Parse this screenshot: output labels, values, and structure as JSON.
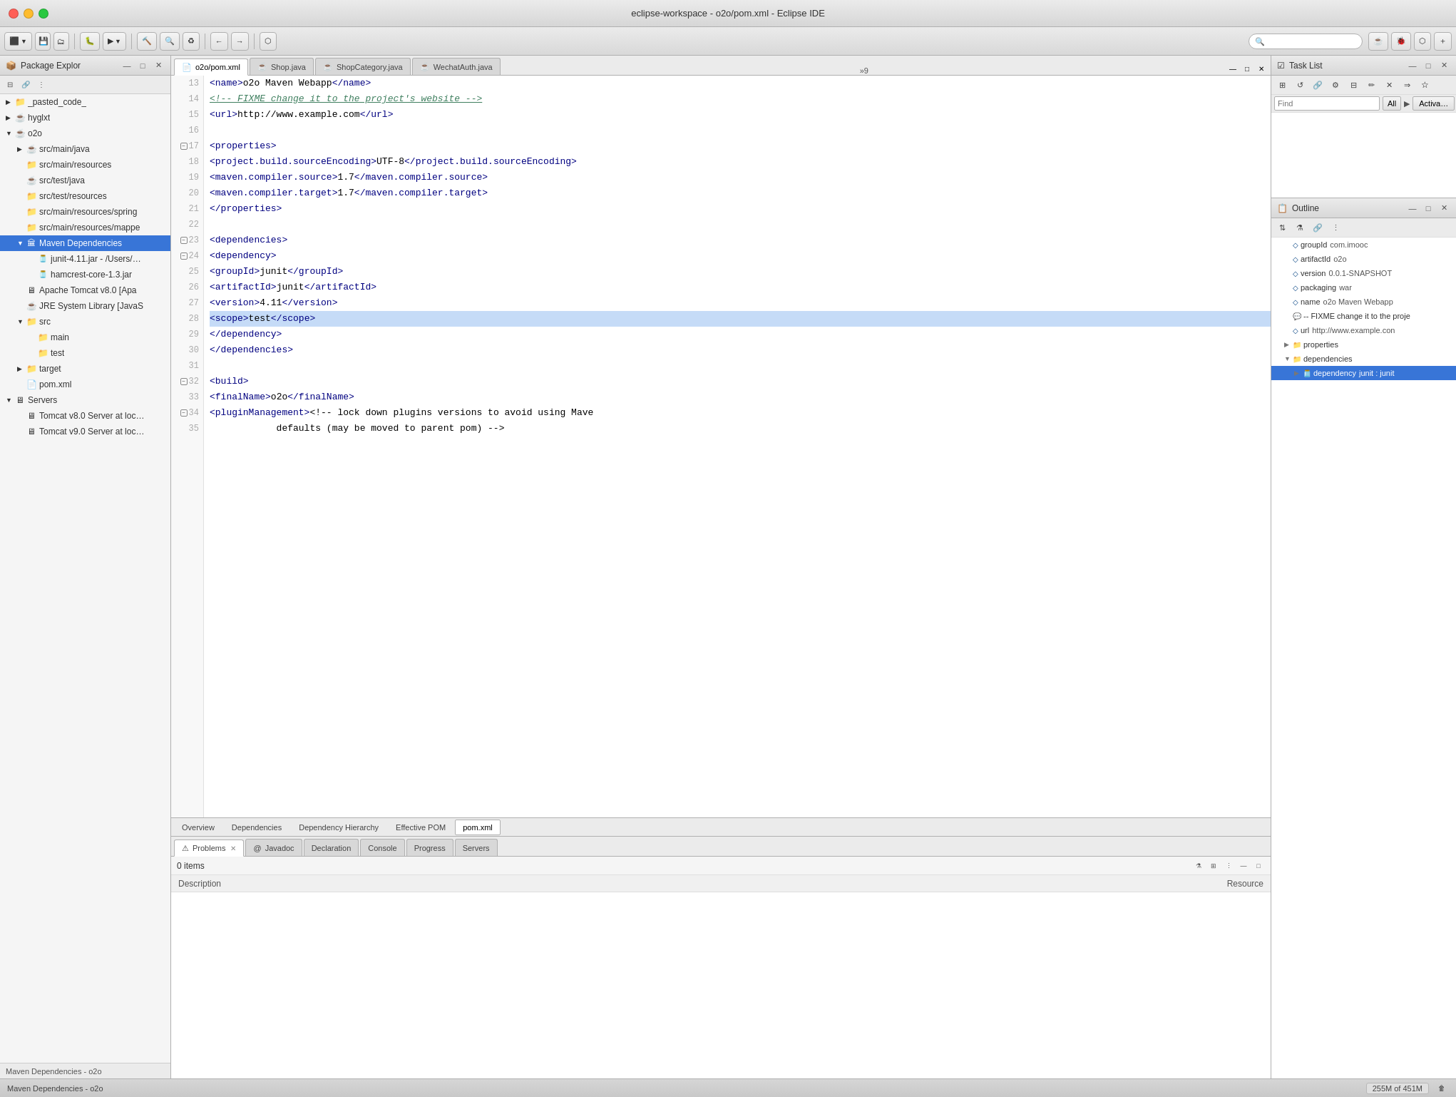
{
  "window": {
    "title": "eclipse-workspace - o2o/pom.xml - Eclipse IDE",
    "traffic_lights": [
      "close",
      "minimize",
      "maximize"
    ]
  },
  "titlebar": {
    "icon": "🔒",
    "title": "eclipse-workspace - o2o/pom.xml - Eclipse IDE"
  },
  "editor_tabs": [
    {
      "id": "pom-xml",
      "label": "o2o/pom.xml",
      "icon": "xml",
      "active": false,
      "closeable": true
    },
    {
      "id": "shop-java",
      "label": "Shop.java",
      "icon": "java",
      "active": false,
      "closeable": true
    },
    {
      "id": "shopcategory-java",
      "label": "ShopCategory.java",
      "icon": "java",
      "active": false,
      "closeable": true
    },
    {
      "id": "wechatauth-java",
      "label": "WechatAuth.java",
      "icon": "java",
      "active": false,
      "closeable": true
    }
  ],
  "editor_tab_overflow": "»9",
  "code_lines": [
    {
      "num": "13",
      "content": "    <name>o2o Maven Webapp</name>",
      "fold": false,
      "highlighted": false
    },
    {
      "num": "14",
      "content": "    <!-- FIXME change it to the project's website -->",
      "fold": false,
      "highlighted": false
    },
    {
      "num": "15",
      "content": "    <url>http://www.example.com</url>",
      "fold": false,
      "highlighted": false
    },
    {
      "num": "16",
      "content": "",
      "fold": false,
      "highlighted": false
    },
    {
      "num": "17",
      "content": "    <properties>",
      "fold": true,
      "highlighted": false
    },
    {
      "num": "18",
      "content": "        <project.build.sourceEncoding>UTF-8</project.build.sourceEncoding>",
      "fold": false,
      "highlighted": false
    },
    {
      "num": "19",
      "content": "        <maven.compiler.source>1.7</maven.compiler.source>",
      "fold": false,
      "highlighted": false
    },
    {
      "num": "20",
      "content": "        <maven.compiler.target>1.7</maven.compiler.target>",
      "fold": false,
      "highlighted": false
    },
    {
      "num": "21",
      "content": "    </properties>",
      "fold": false,
      "highlighted": false
    },
    {
      "num": "22",
      "content": "",
      "fold": false,
      "highlighted": false
    },
    {
      "num": "23",
      "content": "    <dependencies>",
      "fold": true,
      "highlighted": false
    },
    {
      "num": "24",
      "content": "        <dependency>",
      "fold": true,
      "highlighted": false
    },
    {
      "num": "25",
      "content": "            <groupId>junit</groupId>",
      "fold": false,
      "highlighted": false
    },
    {
      "num": "26",
      "content": "            <artifactId>junit</artifactId>",
      "fold": false,
      "highlighted": false
    },
    {
      "num": "27",
      "content": "            <version>4.11</version>",
      "fold": false,
      "highlighted": false
    },
    {
      "num": "28",
      "content": "            <scope>test</scope>",
      "fold": false,
      "highlighted": true
    },
    {
      "num": "29",
      "content": "        </dependency>",
      "fold": false,
      "highlighted": false
    },
    {
      "num": "30",
      "content": "    </dependencies>",
      "fold": false,
      "highlighted": false
    },
    {
      "num": "31",
      "content": "",
      "fold": false,
      "highlighted": false
    },
    {
      "num": "32",
      "content": "    <build>",
      "fold": true,
      "highlighted": false
    },
    {
      "num": "33",
      "content": "        <finalName>o2o</finalName>",
      "fold": false,
      "highlighted": false
    },
    {
      "num": "34",
      "content": "        <pluginManagement><!-- lock down plugins versions to avoid using Mave",
      "fold": true,
      "highlighted": false
    },
    {
      "num": "35",
      "content": "            defaults (may be moved to parent pom) -->",
      "fold": false,
      "highlighted": false
    }
  ],
  "bottom_editor_tabs": [
    {
      "label": "Overview"
    },
    {
      "label": "Dependencies"
    },
    {
      "label": "Dependency Hierarchy"
    },
    {
      "label": "Effective POM"
    },
    {
      "label": "pom.xml",
      "active": true
    }
  ],
  "package_explorer": {
    "title": "Package Explor",
    "items": [
      {
        "level": 0,
        "label": "_pasted_code_",
        "arrow": "▶",
        "icon": "📁",
        "type": "folder"
      },
      {
        "level": 0,
        "label": "hyglxt",
        "arrow": "▶",
        "icon": "☕",
        "type": "project"
      },
      {
        "level": 0,
        "label": "o2o",
        "arrow": "▼",
        "icon": "☕",
        "type": "project"
      },
      {
        "level": 1,
        "label": "src/main/java",
        "arrow": "▶",
        "icon": "📁",
        "type": "src"
      },
      {
        "level": 1,
        "label": "src/main/resources",
        "arrow": " ",
        "icon": "📁",
        "type": "res"
      },
      {
        "level": 1,
        "label": "src/test/java",
        "arrow": " ",
        "icon": "📁",
        "type": "src"
      },
      {
        "level": 1,
        "label": "src/test/resources",
        "arrow": " ",
        "icon": "📁",
        "type": "res"
      },
      {
        "level": 1,
        "label": "src/main/resources/spring",
        "arrow": " ",
        "icon": "📁",
        "type": "res"
      },
      {
        "level": 1,
        "label": "src/main/resources/mappe",
        "arrow": " ",
        "icon": "📁",
        "type": "res"
      },
      {
        "level": 1,
        "label": "Maven Dependencies",
        "arrow": "▼",
        "icon": "🏛",
        "type": "mvn",
        "selected": true
      },
      {
        "level": 2,
        "label": "junit-4.11.jar - /Users/…",
        "arrow": " ",
        "icon": "🫙",
        "type": "jar"
      },
      {
        "level": 2,
        "label": "hamcrest-core-1.3.jar",
        "arrow": " ",
        "icon": "🫙",
        "type": "jar"
      },
      {
        "level": 1,
        "label": "Apache Tomcat v8.0 [Apa",
        "arrow": " ",
        "icon": "🐱",
        "type": "server"
      },
      {
        "level": 1,
        "label": "JRE System Library [JavaS",
        "arrow": " ",
        "icon": "☕",
        "type": "jre"
      },
      {
        "level": 1,
        "label": "src",
        "arrow": "▼",
        "icon": "📁",
        "type": "folder"
      },
      {
        "level": 2,
        "label": "main",
        "arrow": " ",
        "icon": "📁",
        "type": "folder"
      },
      {
        "level": 2,
        "label": "test",
        "arrow": " ",
        "icon": "📁",
        "type": "folder"
      },
      {
        "level": 1,
        "label": "target",
        "arrow": "▶",
        "icon": "📁",
        "type": "folder"
      },
      {
        "level": 1,
        "label": "pom.xml",
        "arrow": " ",
        "icon": "📄",
        "type": "file"
      },
      {
        "level": 0,
        "label": "Servers",
        "arrow": "▼",
        "icon": "🖥",
        "type": "server-group"
      },
      {
        "level": 1,
        "label": "Tomcat v8.0 Server at loc…",
        "arrow": " ",
        "icon": "🖥",
        "type": "server-inst"
      },
      {
        "level": 1,
        "label": "Tomcat v9.0 Server at loc…",
        "arrow": " ",
        "icon": "🖥",
        "type": "server-inst"
      }
    ],
    "footer": "Maven Dependencies - o2o"
  },
  "bottom_panel": {
    "tabs": [
      {
        "label": "Problems",
        "icon": "⚠",
        "active": true,
        "closeable": true
      },
      {
        "label": "Javadoc",
        "icon": "@",
        "active": false
      },
      {
        "label": "Declaration",
        "active": false
      },
      {
        "label": "Console",
        "active": false
      },
      {
        "label": "Progress",
        "active": false
      },
      {
        "label": "Servers",
        "active": false
      }
    ],
    "items_count": "0 items",
    "columns": [
      {
        "label": "Description"
      },
      {
        "label": "Resource"
      }
    ]
  },
  "right_panel": {
    "task_list": {
      "title": "Task List",
      "search_placeholder": "Find",
      "filter_label": "All",
      "activate_label": "Activa…"
    },
    "outline": {
      "title": "Outline",
      "items": [
        {
          "level": 1,
          "label": "groupId",
          "value": "com.imooc",
          "arrow": " ",
          "icon": "xml"
        },
        {
          "level": 1,
          "label": "artifactId",
          "value": "o2o",
          "arrow": " ",
          "icon": "xml"
        },
        {
          "level": 1,
          "label": "version",
          "value": "0.0.1-SNAPSHOT",
          "arrow": " ",
          "icon": "xml"
        },
        {
          "level": 1,
          "label": "packaging",
          "value": "war",
          "arrow": " ",
          "icon": "xml"
        },
        {
          "level": 1,
          "label": "name",
          "value": "o2o Maven Webapp",
          "arrow": " ",
          "icon": "xml"
        },
        {
          "level": 1,
          "label": "-- FIXME change it to the proje",
          "value": "",
          "arrow": " ",
          "icon": "comment"
        },
        {
          "level": 1,
          "label": "url",
          "value": "http://www.example.con",
          "arrow": " ",
          "icon": "xml"
        },
        {
          "level": 1,
          "label": "properties",
          "value": "",
          "arrow": "▶",
          "icon": "xml-folder"
        },
        {
          "level": 1,
          "label": "dependencies",
          "value": "",
          "arrow": "▼",
          "icon": "xml-folder"
        },
        {
          "level": 2,
          "label": "dependency",
          "value": "junit : junit",
          "arrow": "▶",
          "icon": "dep",
          "selected": true
        }
      ]
    }
  },
  "status_bar": {
    "left_label": "Maven Dependencies - o2o",
    "memory": "255M of 451M",
    "gc_icon": "🗑"
  }
}
